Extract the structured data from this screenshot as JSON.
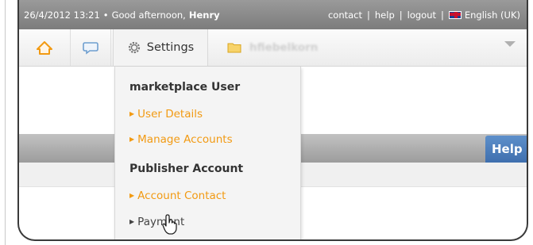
{
  "topbar": {
    "date": "26/4/2012",
    "time": "13:21",
    "bullet": "•",
    "greeting": "Good afternoon,",
    "user_name": "Henry",
    "links": [
      "contact",
      "help",
      "logout"
    ],
    "language": "English (UK)"
  },
  "navbar": {
    "icons": [
      "home-icon",
      "chat-bubble-icon",
      "gear-icon",
      "folder-icon",
      "chevron-down-icon"
    ],
    "settings_label": "Settings",
    "account_name": "hfiebelkorn"
  },
  "dropdown": {
    "section_1_title": "marketplace User",
    "section_1_items": [
      "User Details",
      "Manage Accounts"
    ],
    "section_2_title": "Publisher Account",
    "section_2_items": [
      "Account Contact",
      "Payment"
    ]
  },
  "help_tab": {
    "label": "Help"
  },
  "colors": {
    "link_orange": "#f29a12",
    "help_blue": "#4a7bbd",
    "topbar_gray": "#8a8a8a"
  }
}
